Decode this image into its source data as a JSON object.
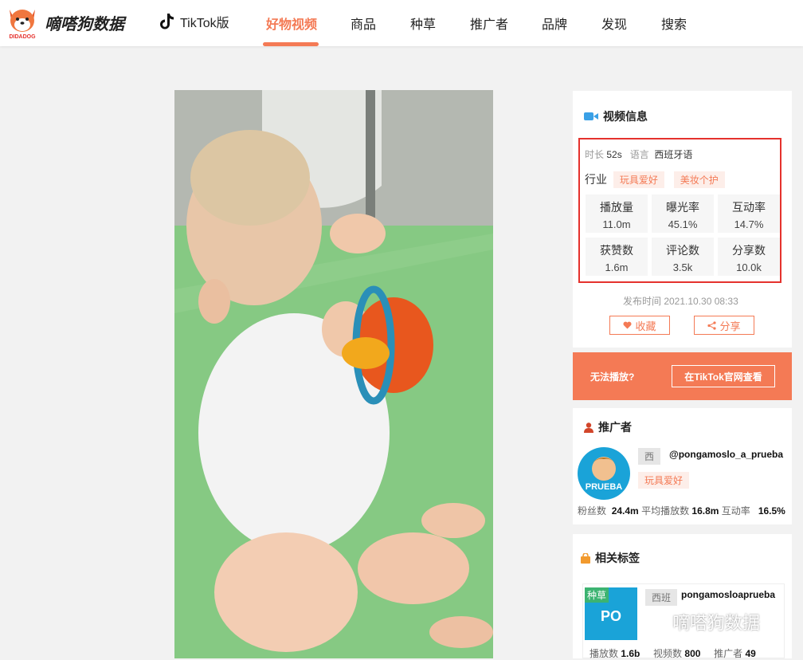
{
  "header": {
    "brand": "嘀嗒狗数据",
    "logo_caption": "DIDADOG",
    "nav_tiktok": "TikTok版",
    "nav_items": [
      "好物视频",
      "商品",
      "种草",
      "推广者",
      "品牌",
      "发现",
      "搜索"
    ],
    "active_nav": "好物视频"
  },
  "video_info": {
    "title": "视频信息",
    "duration_label": "时长",
    "duration": "52s",
    "language_label": "语言",
    "language": "西班牙语",
    "industry_label": "行业",
    "industry_tags": [
      "玩具爱好",
      "美妆个护"
    ],
    "stats": [
      {
        "label": "播放量",
        "value": "11.0m"
      },
      {
        "label": "曝光率",
        "value": "45.1%"
      },
      {
        "label": "互动率",
        "value": "14.7%"
      },
      {
        "label": "获赞数",
        "value": "1.6m"
      },
      {
        "label": "评论数",
        "value": "3.5k"
      },
      {
        "label": "分享数",
        "value": "10.0k"
      }
    ],
    "publish_time": "发布时间 2021.10.30 08:33",
    "favorite_label": "收藏",
    "share_label": "分享"
  },
  "cta": {
    "text": "无法播放?",
    "button": "在TikTok官网查看"
  },
  "promoter": {
    "title": "推广者",
    "avatar_text": "PRUEBA",
    "lang": "西",
    "handle": "@pongamoslo_a_prueba",
    "tag": "玩具爱好",
    "fans_label": "粉丝数",
    "fans": "24.4m",
    "avg_play_label": "平均播放数",
    "avg_play": "16.8m",
    "engagement_label": "互动率",
    "engagement": "16.5%"
  },
  "related_tags": {
    "title": "相关标签",
    "item": {
      "badge": "种草",
      "thumb_text": "PO",
      "lang": "西班",
      "name": "pongamosloaprueba",
      "plays_label": "播放数",
      "plays": "1.6b",
      "videos_label": "视频数",
      "videos": "800",
      "promoters_label": "推广者",
      "promoters": "49"
    }
  },
  "watermark": "嘀嗒狗数据",
  "colors": {
    "accent": "#f47a55",
    "highlight_border": "#e5322d",
    "video_icon": "#3aa0e6"
  }
}
